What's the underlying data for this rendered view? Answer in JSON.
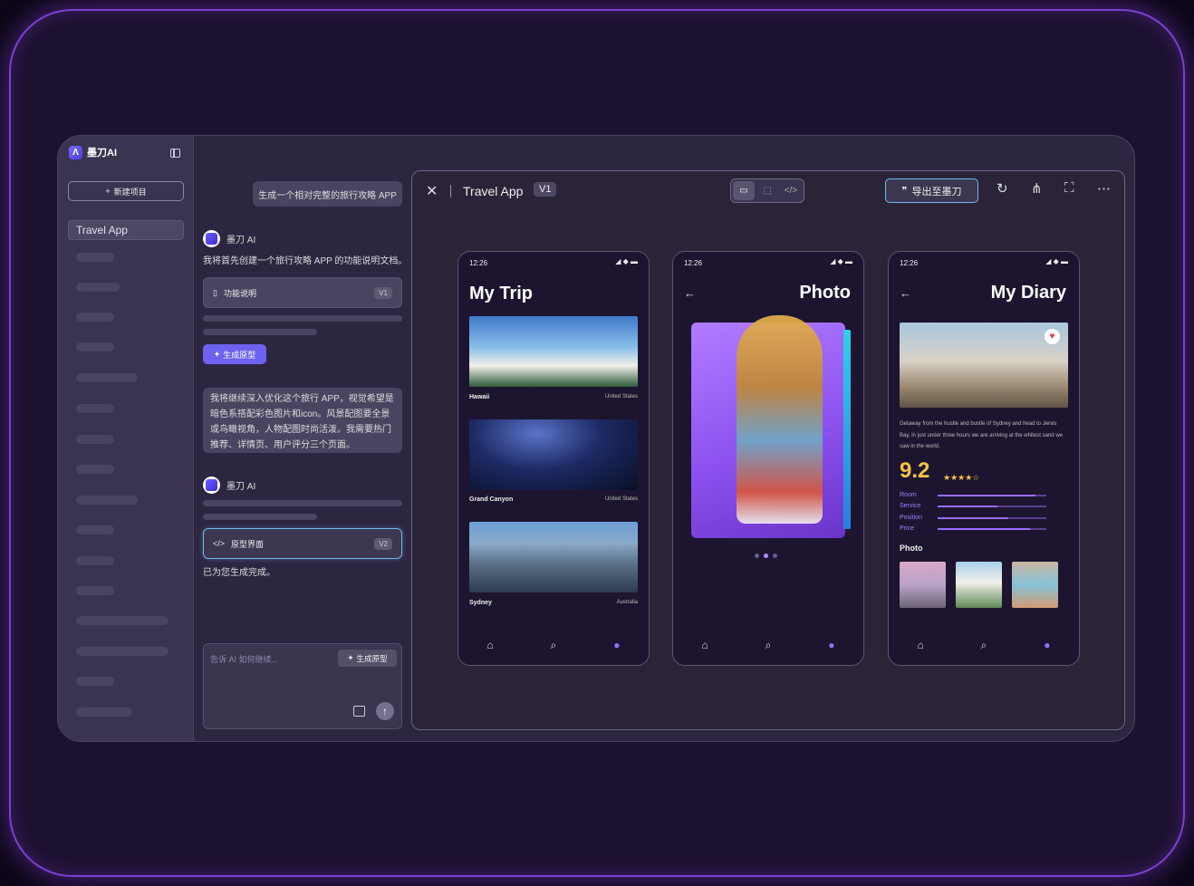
{
  "sidebar": {
    "brand": "墨刀AI",
    "new_project": "新建项目",
    "projects": [
      "Travel App"
    ]
  },
  "chat": {
    "user_prompt": "生成一个相对完整的旅行攻略 APP",
    "ai_name": "墨刀 AI",
    "ai_msg1": "我将首先创建一个旅行攻略 APP 的功能说明文档。",
    "doc_title": "功能说明",
    "doc_version": "V1",
    "gen_label": "生成原型",
    "user_followup": "我将继续深入优化这个旅行 APP，视觉希望是暗色系搭配彩色图片和icon。风景配图要全景或鸟瞰视角，人物配图时尚活泼。我需要热门推荐、详情页、用户评分三个页面。",
    "proto_title": "原型界面",
    "proto_version": "V2",
    "done_msg": "已为您生成完成。",
    "input_placeholder": "告诉 AI 如何继续...",
    "input_gen": "生成原型"
  },
  "preview": {
    "title": "Travel App",
    "version": "V1",
    "export_label": "导出至墨刀"
  },
  "phones": {
    "time": "12:26",
    "trip_title": "My Trip",
    "photo_title": "Photo",
    "diary_title": "My Diary",
    "cards": [
      {
        "name": "Hawaii",
        "country": "United States"
      },
      {
        "name": "Grand Canyon",
        "country": "United States"
      },
      {
        "name": "Sydney",
        "country": "Australia"
      }
    ],
    "diary_text": "Getaway from the hustle and bustle of Sydney and head to Jervis Bay, in just under three hours we are arriving at the whitest sand we saw in the world.",
    "score": "9.2",
    "stars": "★★★★☆",
    "ratings": [
      {
        "label": "Room",
        "value": 0.9
      },
      {
        "label": "Service",
        "value": 0.55
      },
      {
        "label": "Position",
        "value": 0.65
      },
      {
        "label": "Price",
        "value": 0.85
      }
    ],
    "photo_label": "Photo"
  }
}
